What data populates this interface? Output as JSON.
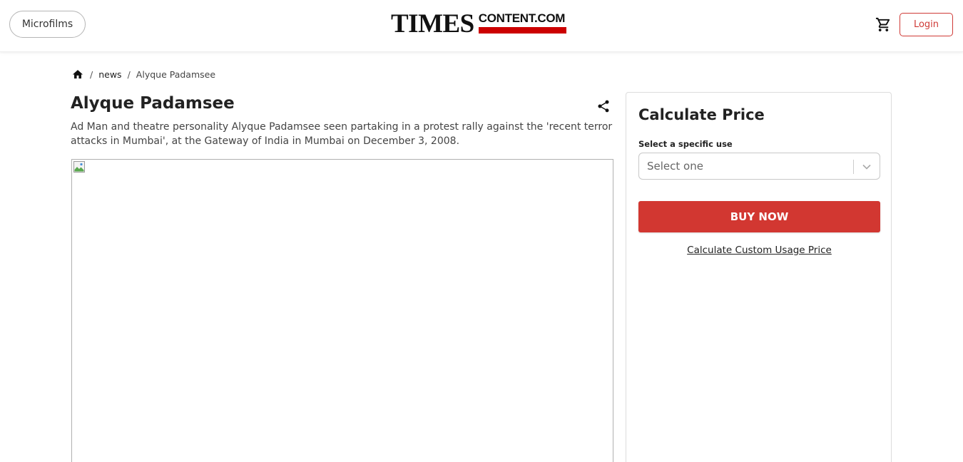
{
  "header": {
    "microfilms_label": "Microfilms",
    "logo": {
      "primary": "TIMES",
      "secondary": "CONTENT.COM"
    },
    "login_label": "Login",
    "icons": {
      "cart": "cart-icon"
    }
  },
  "breadcrumb": {
    "items": [
      {
        "icon": "home-icon"
      },
      {
        "label": "news"
      },
      {
        "label": "Alyque Padamsee"
      }
    ],
    "separator": "/"
  },
  "article": {
    "title": "Alyque Padamsee",
    "description": "Ad Man and theatre personality Alyque Padamsee seen partaking in a protest rally against the 'recent terror attacks in Mumbai', at the Gateway of India in Mumbai on December 3, 2008.",
    "icons": {
      "share": "share-icon",
      "image": "broken-image-icon"
    }
  },
  "price_panel": {
    "title": "Calculate Price",
    "use_label": "Select a specific use",
    "select_placeholder": "Select one",
    "buy_now_label": "BUY NOW",
    "custom_price_label": "Calculate Custom Usage Price"
  },
  "colors": {
    "accent_red": "#d23731",
    "login_border": "#cf3a36",
    "logo_bar": "#cc0000"
  }
}
